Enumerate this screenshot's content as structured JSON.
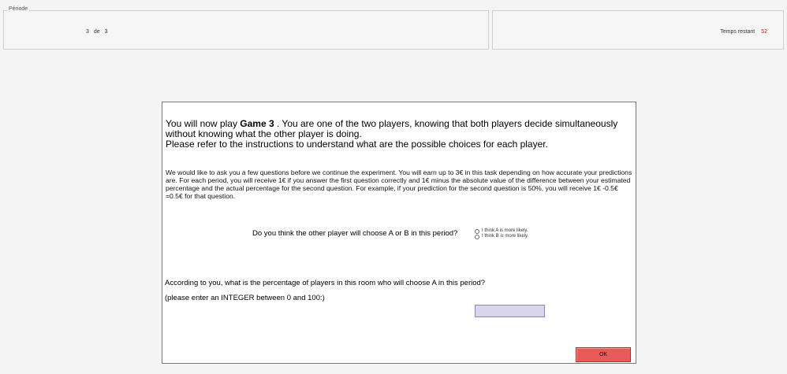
{
  "header": {
    "period_legend": "Période",
    "period_current": "3",
    "period_of": "de",
    "period_total": "3",
    "time_label": "Temps restant",
    "time_value": "52"
  },
  "main": {
    "intro_line1_pre": "You will now play ",
    "intro_game": "Game 3",
    "intro_line1_post": " . You are one of the two players, knowing that both players decide simultaneously without knowing what the other player is doing.",
    "intro_line2": "Please refer to the instructions to understand what are the possible choices for each player.",
    "info_text": "We would like to ask you a few questions before we continue the experiment. You will earn up to 3€  in this task depending on how accurate your predictions are. For each period, you will receive 1€ if you answer the first question correctly and 1€ minus the absolute value of the difference between your estimated percentage and the actual percentage for the second question. For example, if your prediction for the second question is 50%, you will receive 1€ -0.5€ =0.5€  for that question.",
    "question1": "Do you think the other player will choose A or B in this period?",
    "choice_a": "I think A is more likely.",
    "choice_b": "I think B is more likely.",
    "question2": "According to you, what is the percentage of players in this room who will choose A in this period?",
    "question2_note": "(please enter an INTEGER between 0 and 100:)",
    "percentage_value": "",
    "ok_label": "OK"
  },
  "colors": {
    "ok_button": "#e85a5a",
    "input_bg": "#d8d6ea",
    "time_value": "#c02020"
  }
}
